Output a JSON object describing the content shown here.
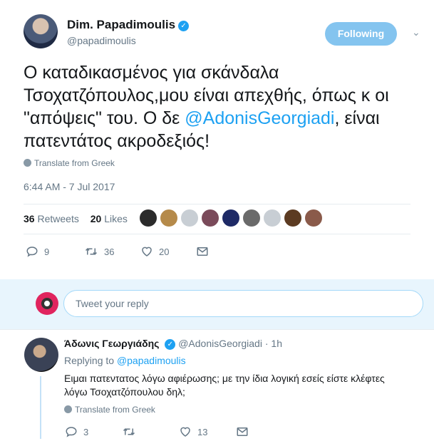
{
  "tweet": {
    "author_name": "Dim. Papadimoulis",
    "verified_glyph": "✓",
    "handle": "@papadimoulis",
    "follow_label": "Following",
    "menu_glyph": "⌄",
    "text_part1": "Ο καταδικασμένος για σκάνδαλα Τσοχατζόπουλος,μου είναι απεχθής, όπως κ οι \"απόψεις\" του. Ο δε ",
    "mention": "@AdonisGeorgiadi",
    "text_part2": ", είναι πατεντάτος ακροδεξιός!",
    "translate": "Translate from Greek",
    "timestamp": "6:44 AM - 7 Jul 2017",
    "retweets_count": "36",
    "retweets_label": "Retweets",
    "likes_count": "20",
    "likes_label": "Likes",
    "liker_colors": [
      "#2b2b2b",
      "#b58a4a",
      "#c8ced4",
      "#7a4a5a",
      "#1e2a66",
      "#6a6a6a",
      "#c8ced4",
      "#5c3b22",
      "#8a5a4a"
    ],
    "actions": {
      "replies": "9",
      "retweets": "36",
      "likes": "20"
    }
  },
  "reply_box": {
    "placeholder": "Tweet your reply"
  },
  "reply": {
    "author_name": "Άδωνις Γεωργιάδης",
    "verified_glyph": "✓",
    "handle": "@AdonisGeorgiadi",
    "separator": "·",
    "time": "1h",
    "replying_prefix": "Replying to",
    "replying_to": "@papadimoulis",
    "text": "Ειμαι πατεντατος λόγω αφιέρωσης; με την ίδια λογική εσείς είστε κλέφτες λόγω Τσοχατζόπουλου δηλ;",
    "translate": "Translate from Greek",
    "actions": {
      "replies": "3",
      "retweets": "",
      "likes": "13"
    }
  },
  "colors": {
    "accent": "#1da1f2",
    "follow_button": "#84c4ef",
    "muted": "#657786",
    "reply_bg": "#e8f5fd"
  }
}
